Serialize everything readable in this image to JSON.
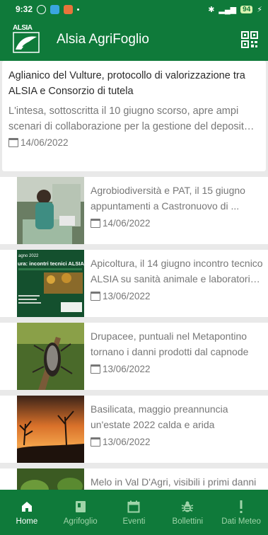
{
  "status_bar": {
    "time": "9:32",
    "battery": "94"
  },
  "app_bar": {
    "logo_text": "ALSIA",
    "title": "Alsia AgriFoglio"
  },
  "featured": {
    "title": "Aglianico del Vulture, protocollo di valorizzazione tra ALSIA e Consorzio di tutela",
    "description": "L'intesa, sottoscritta il 10 giugno scorso, apre ampi scenari di collaborazione per la gestione del deposito ...",
    "date": "14/06/2022"
  },
  "articles": [
    {
      "title": "Agrobiodiversità e PAT, il 15 giugno appuntamenti a Castronuovo di ...",
      "date": "14/06/2022"
    },
    {
      "title": "Apicoltura, il 14 giugno incontro tecnico ALSIA su sanità animale e laboratori a...",
      "date": "13/06/2022",
      "thumb_text": [
        "agno 2022",
        "ura: incontri tecnici ALSIA"
      ]
    },
    {
      "title": "Drupacee, puntuali nel Metapontino tornano i danni prodotti dal capnode",
      "date": "13/06/2022"
    },
    {
      "title": "Basilicata, maggio preannuncia un'estate 2022 calda e arida",
      "date": "13/06/2022"
    },
    {
      "title": "Melo in Val D'Agri, visibili i primi danni da carpocapsa sui frutti",
      "date": ""
    }
  ],
  "nav": [
    {
      "label": "Home",
      "icon": "home-icon",
      "active": true
    },
    {
      "label": "Agrifoglio",
      "icon": "book-icon",
      "active": false
    },
    {
      "label": "Eventi",
      "icon": "calendar-icon",
      "active": false
    },
    {
      "label": "Bollettini",
      "icon": "bug-icon",
      "active": false
    },
    {
      "label": "Dati Meteo",
      "icon": "exclamation-icon",
      "active": false
    }
  ],
  "colors": {
    "primary": "#0f7a3a",
    "nav_inactive": "#9fd4a9",
    "text_muted": "#777777"
  }
}
